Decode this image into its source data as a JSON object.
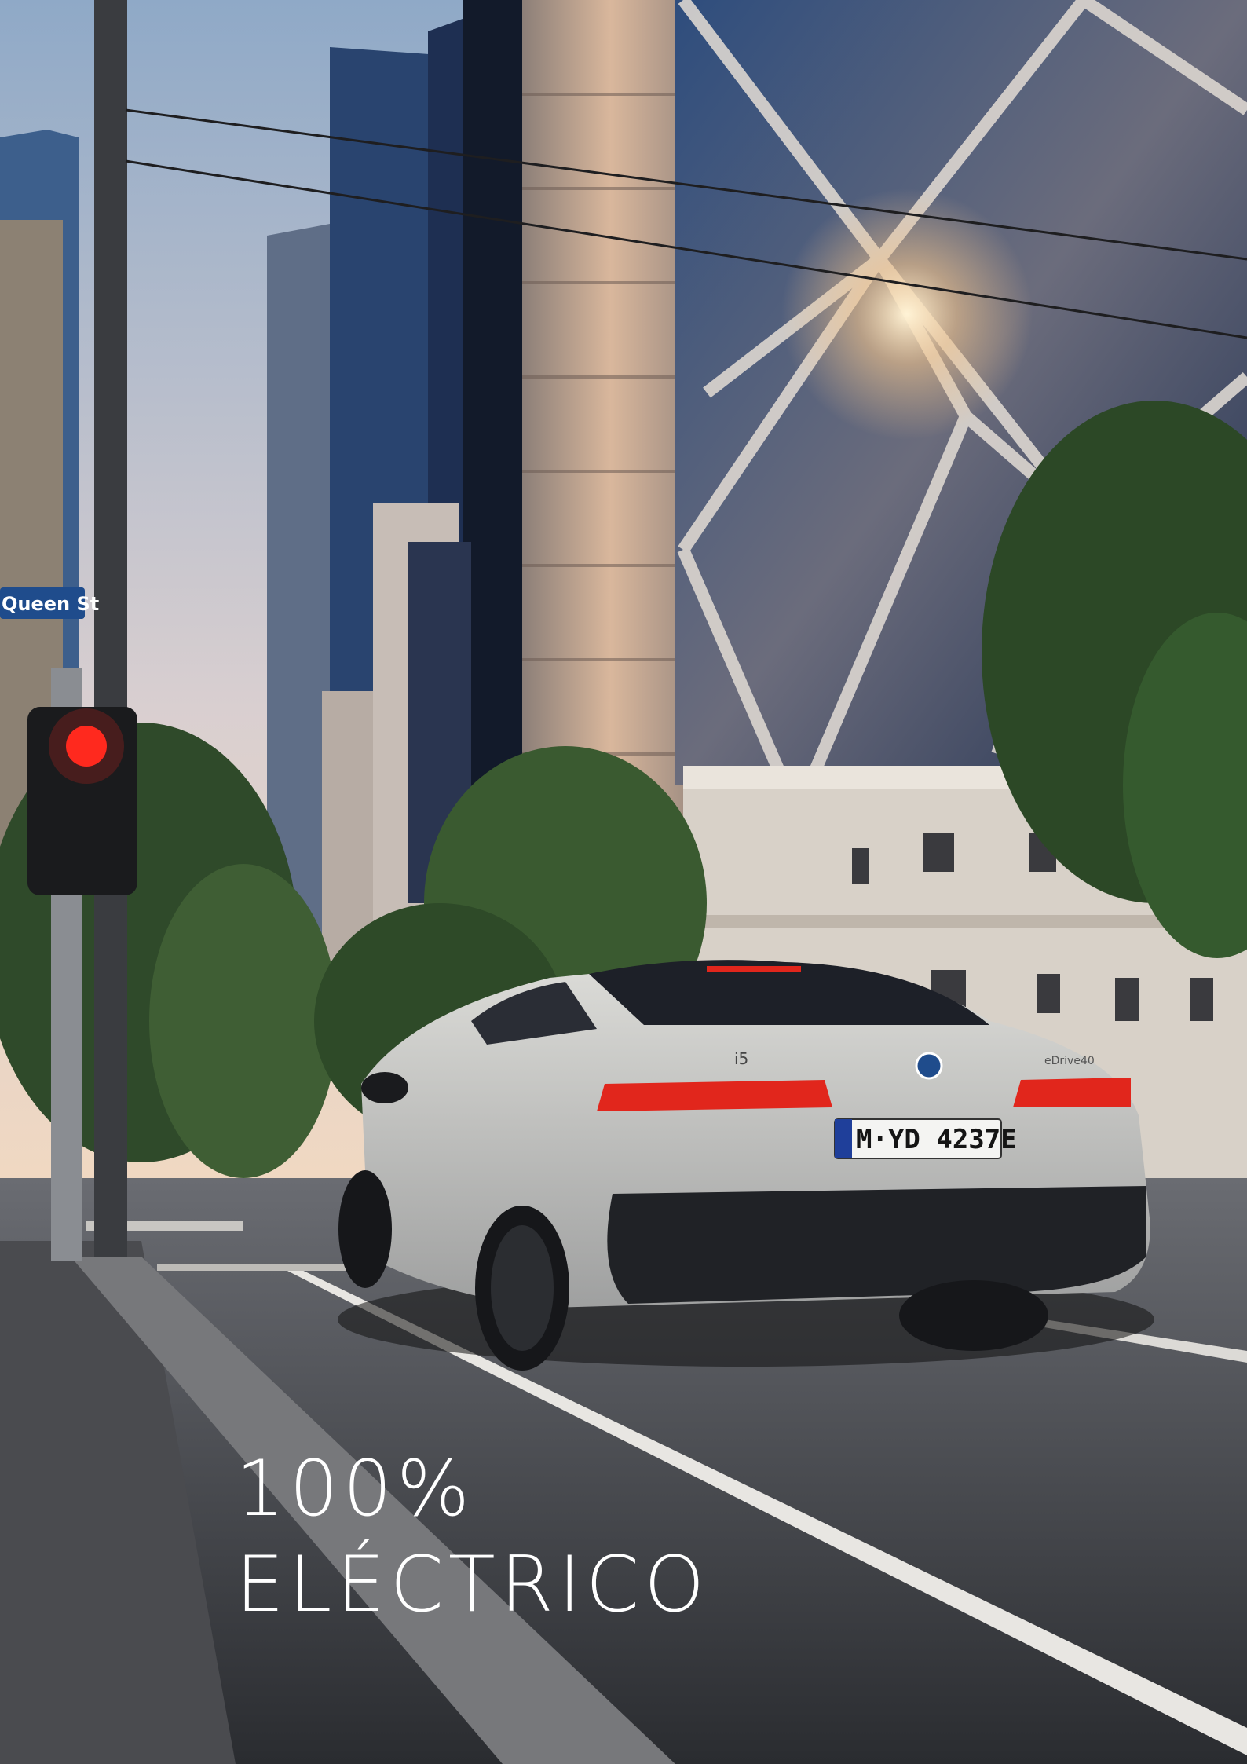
{
  "street_sign": {
    "text": "Queen St"
  },
  "car": {
    "license_plate": "M·YD 4237E",
    "model_badge": "i5",
    "variant_badge": "eDrive40"
  },
  "headline": {
    "line1": "100%",
    "line2": "ELÉCTRICO"
  },
  "colors": {
    "sky_top": "#8fa9c7",
    "sky_bottom": "#f0d8c2",
    "car_body": "#c9c9c6",
    "tail_light": "#e1261c",
    "traffic_light": "#ff2a1f",
    "headline_text": "#ffffff"
  }
}
